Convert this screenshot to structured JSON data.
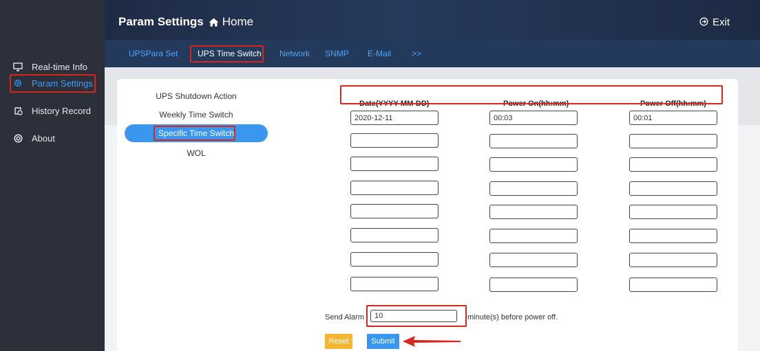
{
  "sidebar": {
    "items": [
      {
        "label": "Real-time Info",
        "icon": "monitor-icon"
      },
      {
        "label": "Param Settings",
        "icon": "gear-icon"
      },
      {
        "label": "History Record",
        "icon": "history-icon"
      },
      {
        "label": "About",
        "icon": "about-icon"
      }
    ]
  },
  "header": {
    "title": "Param Settings",
    "home": "Home",
    "exit": "Exit"
  },
  "tabs": [
    "UPSPara Set",
    "UPS Time Switch",
    "Network",
    "SNMP",
    "E-Mail",
    ">>"
  ],
  "subnav": [
    "UPS Shutdown Action",
    "Weekly Time Switch",
    "Specific Time Switch",
    "WOL"
  ],
  "table": {
    "headers": [
      "Date(YYYY-MM-DD)",
      "Power On(hh:mm)",
      "Power Off(hh:mm)"
    ],
    "rows": [
      [
        "2020-12-11",
        "00:03",
        "00:01"
      ],
      [
        "",
        "",
        ""
      ],
      [
        "",
        "",
        ""
      ],
      [
        "",
        "",
        ""
      ],
      [
        "",
        "",
        ""
      ],
      [
        "",
        "",
        ""
      ],
      [
        "",
        "",
        ""
      ],
      [
        "",
        "",
        ""
      ]
    ]
  },
  "alarm": {
    "label": "Send Alarm",
    "value": "10",
    "suffix": "minute(s) before power off."
  },
  "buttons": {
    "reset": "Reset",
    "submit": "Submit"
  },
  "colors": {
    "sidebar": "#2b303b",
    "accent": "#3a97f0",
    "highlight": "#d9251c",
    "reset": "#f5b731"
  }
}
